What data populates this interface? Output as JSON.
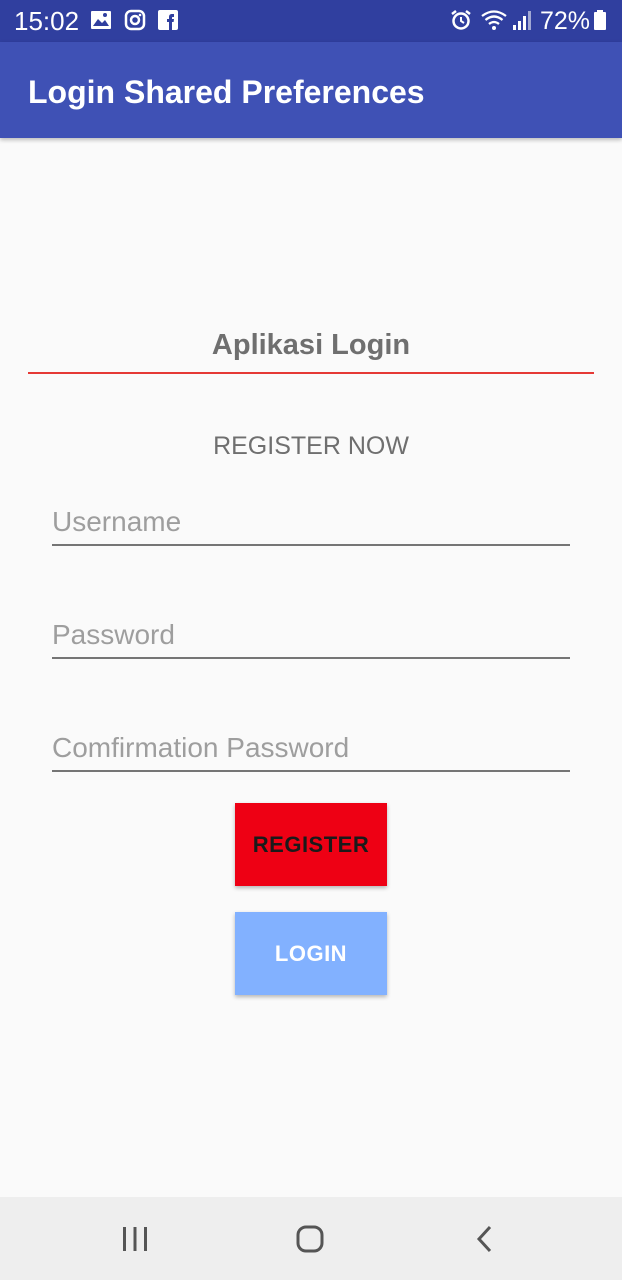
{
  "status_bar": {
    "time": "15:02",
    "battery": "72%",
    "icons": [
      "gallery-icon",
      "instagram-icon",
      "facebook-icon",
      "alarm-icon",
      "wifi-icon",
      "signal-icon",
      "battery-icon"
    ]
  },
  "app_bar": {
    "title": "Login Shared Preferences"
  },
  "form": {
    "heading": "Aplikasi Login",
    "subheading": "REGISTER NOW",
    "username_placeholder": "Username",
    "password_placeholder": "Password",
    "confirm_placeholder": "Comfirmation Password",
    "register_label": "REGISTER",
    "login_label": "LOGIN"
  },
  "nav_bar": {
    "icons": [
      "recent-apps-icon",
      "home-icon",
      "back-icon"
    ]
  },
  "colors": {
    "status_bar": "#303f9f",
    "app_bar": "#3f51b5",
    "divider": "#e53935",
    "register_button": "#ee0014",
    "login_button": "#82b1ff"
  }
}
